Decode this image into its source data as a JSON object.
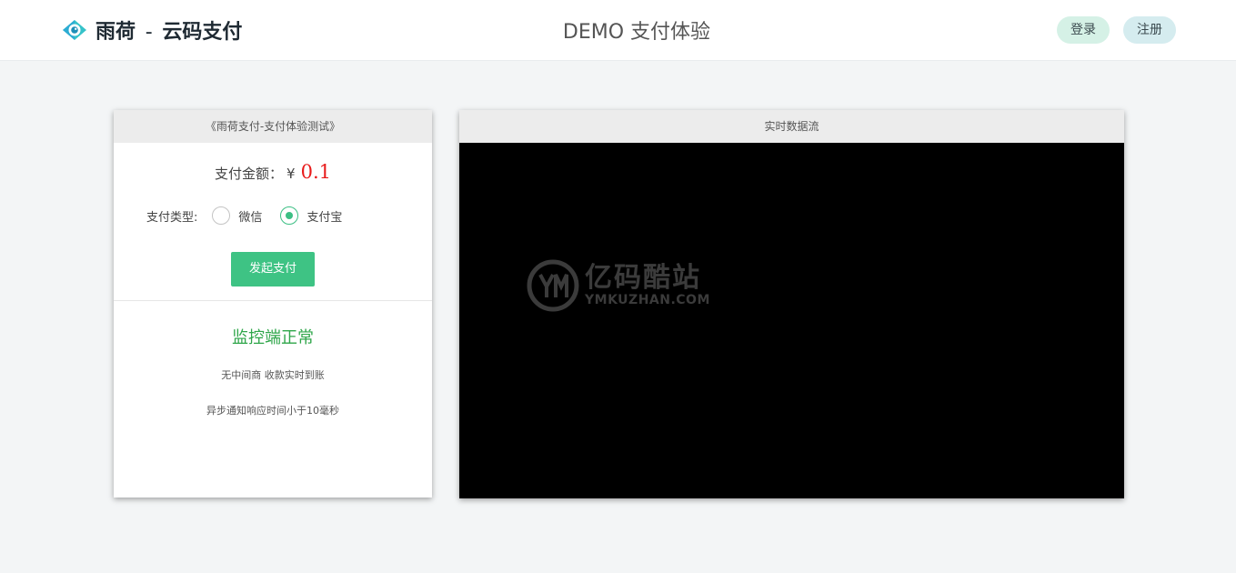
{
  "header": {
    "brand_name": "雨荷",
    "brand_sep": "-",
    "brand_suffix": "云码支付",
    "page_title": "DEMO 支付体验",
    "login_label": "登录",
    "register_label": "注册"
  },
  "payment_panel": {
    "title": "《雨荷支付-支付体验测试》",
    "amount_label": "支付金额：",
    "currency_symbol": "¥",
    "amount_value": "0.1",
    "type_label": "支付类型:",
    "options": [
      {
        "label": "微信",
        "checked": false
      },
      {
        "label": "支付宝",
        "checked": true
      }
    ],
    "submit_label": "发起支付",
    "monitor_status": "监控端正常",
    "info_lines": [
      "无中间商 收款实时到账",
      "异步通知响应时间小于10毫秒"
    ]
  },
  "stream_panel": {
    "title": "实时数据流",
    "watermark_cn": "亿码酷站",
    "watermark_en": "YMKUZHAN.COM"
  },
  "colors": {
    "accent_green": "#3ec384",
    "amount_red": "#e81a1a",
    "status_green": "#2fa64a"
  }
}
